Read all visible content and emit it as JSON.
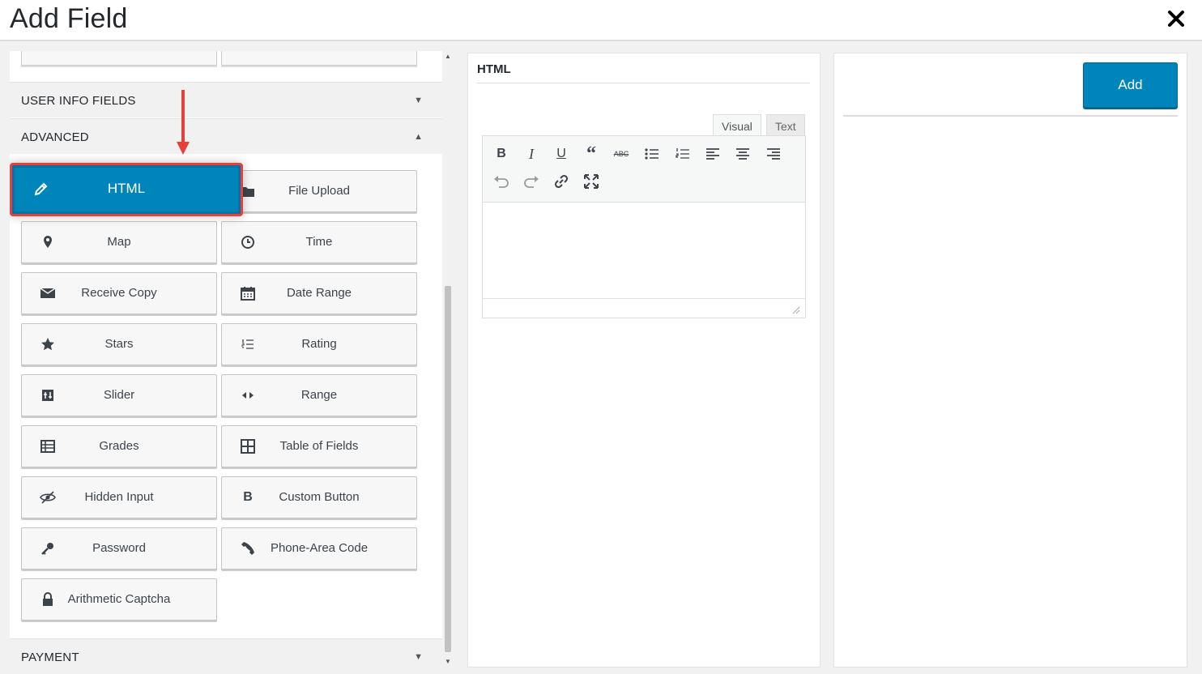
{
  "modal": {
    "title": "Add Field",
    "close_icon": "close-icon"
  },
  "sections": {
    "user_info": {
      "label": "USER INFO FIELDS",
      "state": "collapsed"
    },
    "advanced": {
      "label": "ADVANCED",
      "state": "expanded"
    },
    "payment": {
      "label": "PAYMENT",
      "state": "collapsed"
    }
  },
  "fields": {
    "html": {
      "label": "HTML",
      "icon": "pencil-icon"
    },
    "file_upload": {
      "label": "File Upload",
      "icon": "folder-icon"
    },
    "map": {
      "label": "Map",
      "icon": "map-pin-icon"
    },
    "time": {
      "label": "Time",
      "icon": "clock-icon"
    },
    "receive_copy": {
      "label": "Receive Copy",
      "icon": "envelope-icon"
    },
    "date_range": {
      "label": "Date Range",
      "icon": "calendar-icon"
    },
    "stars": {
      "label": "Stars",
      "icon": "star-icon"
    },
    "rating": {
      "label": "Rating",
      "icon": "list-ordered-icon"
    },
    "slider": {
      "label": "Slider",
      "icon": "slider-icon"
    },
    "range": {
      "label": "Range",
      "icon": "arrows-horizontal-icon"
    },
    "grades": {
      "label": "Grades",
      "icon": "grades-icon"
    },
    "table_of_fields": {
      "label": "Table of Fields",
      "icon": "table-icon"
    },
    "hidden_input": {
      "label": "Hidden Input",
      "icon": "eye-slash-icon"
    },
    "custom_button": {
      "label": "Custom Button",
      "icon": "bold-b-icon"
    },
    "password": {
      "label": "Password",
      "icon": "key-icon"
    },
    "phone_area_code": {
      "label": "Phone-Area Code",
      "icon": "phone-icon"
    },
    "arithmetic_captcha": {
      "label": "Arithmetic Captcha",
      "icon": "lock-icon"
    }
  },
  "editor": {
    "title": "HTML",
    "tabs": {
      "visual": "Visual",
      "text": "Text"
    },
    "active_tab": "Visual",
    "toolbar_row1": [
      "bold",
      "italic",
      "underline",
      "blockquote",
      "strikethrough",
      "bullet-list",
      "numbered-list",
      "align-left",
      "align-center",
      "align-right"
    ],
    "toolbar_row2": [
      "undo",
      "redo",
      "link",
      "fullscreen"
    ],
    "content": ""
  },
  "actions": {
    "add_label": "Add"
  },
  "colors": {
    "primary": "#0085ba",
    "highlight_border": "#e5403a",
    "arrow": "#e5403a"
  }
}
